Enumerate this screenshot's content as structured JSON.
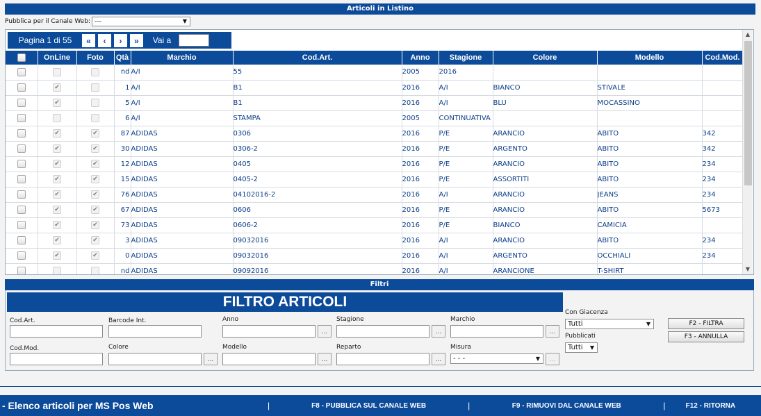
{
  "title": "Articoli in Listino",
  "publish": {
    "label": "Pubblica per il Canale Web:",
    "value": "---"
  },
  "pager": {
    "info": "Pagina 1 di 55",
    "first": "«",
    "prev": "‹",
    "next": "›",
    "last": "»",
    "goto": "Vai a"
  },
  "columns": [
    "",
    "OnLine",
    "Foto",
    "Qtà",
    "Marchio",
    "Cod.Art.",
    "Anno",
    "Stagione",
    "Colore",
    "Modello",
    "Cod.Mod."
  ],
  "rows": [
    {
      "online": false,
      "foto": false,
      "qta": "nd",
      "marchio": "A/I",
      "codart": "55",
      "anno": "2005",
      "stagione": "2016",
      "colore": "",
      "modello": "",
      "codmod": ""
    },
    {
      "online": true,
      "foto": false,
      "qta": "1",
      "marchio": "A/I",
      "codart": "B1",
      "anno": "2016",
      "stagione": "A/I",
      "colore": "BIANCO",
      "modello": "STIVALE",
      "codmod": ""
    },
    {
      "online": true,
      "foto": false,
      "qta": "5",
      "marchio": "A/I",
      "codart": "B1",
      "anno": "2016",
      "stagione": "A/I",
      "colore": "BLU",
      "modello": "MOCASSINO",
      "codmod": ""
    },
    {
      "online": false,
      "foto": false,
      "qta": "6",
      "marchio": "A/I",
      "codart": "STAMPA",
      "anno": "2005",
      "stagione": "CONTINUATIVA",
      "colore": "",
      "modello": "",
      "codmod": ""
    },
    {
      "online": true,
      "foto": true,
      "qta": "87",
      "marchio": "ADIDAS",
      "codart": "0306",
      "anno": "2016",
      "stagione": "P/E",
      "colore": "ARANCIO",
      "modello": "ABITO",
      "codmod": "342"
    },
    {
      "online": true,
      "foto": true,
      "qta": "30",
      "marchio": "ADIDAS",
      "codart": "0306-2",
      "anno": "2016",
      "stagione": "P/E",
      "colore": "ARGENTO",
      "modello": "ABITO",
      "codmod": "342"
    },
    {
      "online": true,
      "foto": true,
      "qta": "12",
      "marchio": "ADIDAS",
      "codart": "0405",
      "anno": "2016",
      "stagione": "P/E",
      "colore": "ARANCIO",
      "modello": "ABITO",
      "codmod": "234"
    },
    {
      "online": true,
      "foto": true,
      "qta": "15",
      "marchio": "ADIDAS",
      "codart": "0405-2",
      "anno": "2016",
      "stagione": "P/E",
      "colore": "ASSORTITI",
      "modello": "ABITO",
      "codmod": "234"
    },
    {
      "online": true,
      "foto": true,
      "qta": "76",
      "marchio": "ADIDAS",
      "codart": "04102016-2",
      "anno": "2016",
      "stagione": "A/I",
      "colore": "ARANCIO",
      "modello": "JEANS",
      "codmod": "234"
    },
    {
      "online": true,
      "foto": true,
      "qta": "67",
      "marchio": "ADIDAS",
      "codart": "0606",
      "anno": "2016",
      "stagione": "P/E",
      "colore": "ARANCIO",
      "modello": "ABITO",
      "codmod": "5673"
    },
    {
      "online": true,
      "foto": true,
      "qta": "73",
      "marchio": "ADIDAS",
      "codart": "0606-2",
      "anno": "2016",
      "stagione": "P/E",
      "colore": "BIANCO",
      "modello": "CAMICIA",
      "codmod": ""
    },
    {
      "online": true,
      "foto": true,
      "qta": "3",
      "marchio": "ADIDAS",
      "codart": "09032016",
      "anno": "2016",
      "stagione": "A/I",
      "colore": "ARANCIO",
      "modello": "ABITO",
      "codmod": "234"
    },
    {
      "online": true,
      "foto": true,
      "qta": "0",
      "marchio": "ADIDAS",
      "codart": "09032016",
      "anno": "2016",
      "stagione": "A/I",
      "colore": "ARGENTO",
      "modello": "OCCHIALI",
      "codmod": "234"
    },
    {
      "online": false,
      "foto": false,
      "qta": "nd",
      "marchio": "ADIDAS",
      "codart": "09092016",
      "anno": "2016",
      "stagione": "A/I",
      "colore": "ARANCIONE",
      "modello": "T-SHIRT",
      "codmod": ""
    }
  ],
  "filters": {
    "section_title": "Filtri",
    "banner": "FILTRO ARTICOLI",
    "cod_art": "Cod.Art.",
    "barcode": "Barcode Int.",
    "anno": "Anno",
    "stagione": "Stagione",
    "marchio": "Marchio",
    "cod_mod": "Cod.Mod.",
    "colore": "Colore",
    "modello": "Modello",
    "reparto": "Reparto",
    "misura": "Misura",
    "misura_value": "- - -",
    "browse": "...",
    "con_giacenza": "Con Giacenza",
    "con_giacenza_value": "Tutti",
    "pubblicati": "Pubblicati",
    "pubblicati_value": "Tutti",
    "btn_filtra": "F2 - FILTRA",
    "btn_annulla": "F3 - ANNULLA"
  },
  "footer": {
    "title": "- Elenco articoli per MS Pos Web",
    "sep": "|",
    "f8": "F8 - PUBBLICA SUL CANALE WEB",
    "f9": "F9 - RIMUOVI DAL CANALE WEB",
    "f12": "F12 - RITORNA"
  },
  "icons": {
    "checkmark": "✔",
    "dropdown": "▼",
    "scroll_up": "▲",
    "scroll_down": "▼"
  },
  "colors": {
    "accent": "#0c4a9a",
    "cell_text": "#0c3e88"
  }
}
